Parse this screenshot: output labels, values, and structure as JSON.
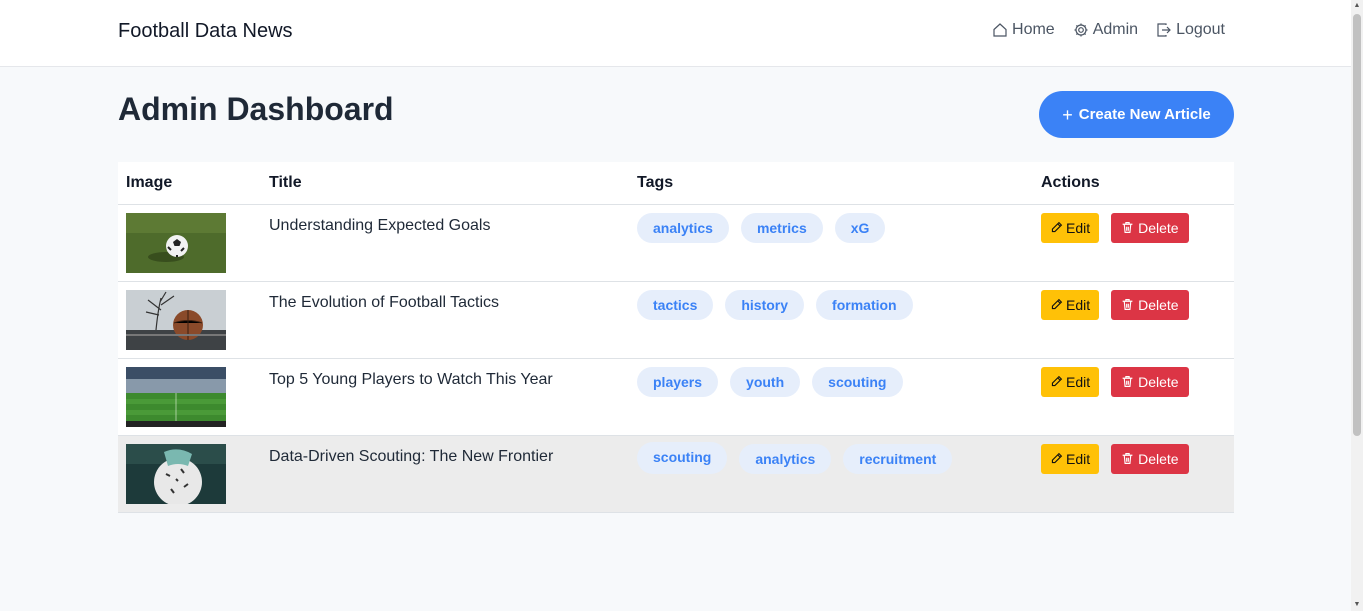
{
  "brand": "Football Data News",
  "nav": {
    "home": "Home",
    "admin": "Admin",
    "logout": "Logout"
  },
  "page_title": "Admin Dashboard",
  "create_button": "Create New Article",
  "table": {
    "headers": [
      "Image",
      "Title",
      "Tags",
      "Actions"
    ],
    "rows": [
      {
        "title": "Understanding Expected Goals",
        "tags": [
          "analytics",
          "metrics",
          "xG"
        ],
        "image": "soccer-ball-on-grass"
      },
      {
        "title": "The Evolution of Football Tactics",
        "tags": [
          "tactics",
          "history",
          "formation"
        ],
        "image": "ball-under-tree"
      },
      {
        "title": "Top 5 Young Players to Watch This Year",
        "tags": [
          "players",
          "youth",
          "scouting"
        ],
        "image": "stadium-pitch"
      },
      {
        "title": "Data-Driven Scouting: The New Frontier",
        "tags": [
          "scouting",
          "analytics",
          "recruitment"
        ],
        "image": "player-holding-ball"
      }
    ]
  },
  "actions": {
    "edit": "Edit",
    "delete": "Delete"
  },
  "colors": {
    "primary": "#3b82f6",
    "edit": "#ffc107",
    "delete": "#dc3545",
    "tag_bg": "#e6eefb"
  }
}
